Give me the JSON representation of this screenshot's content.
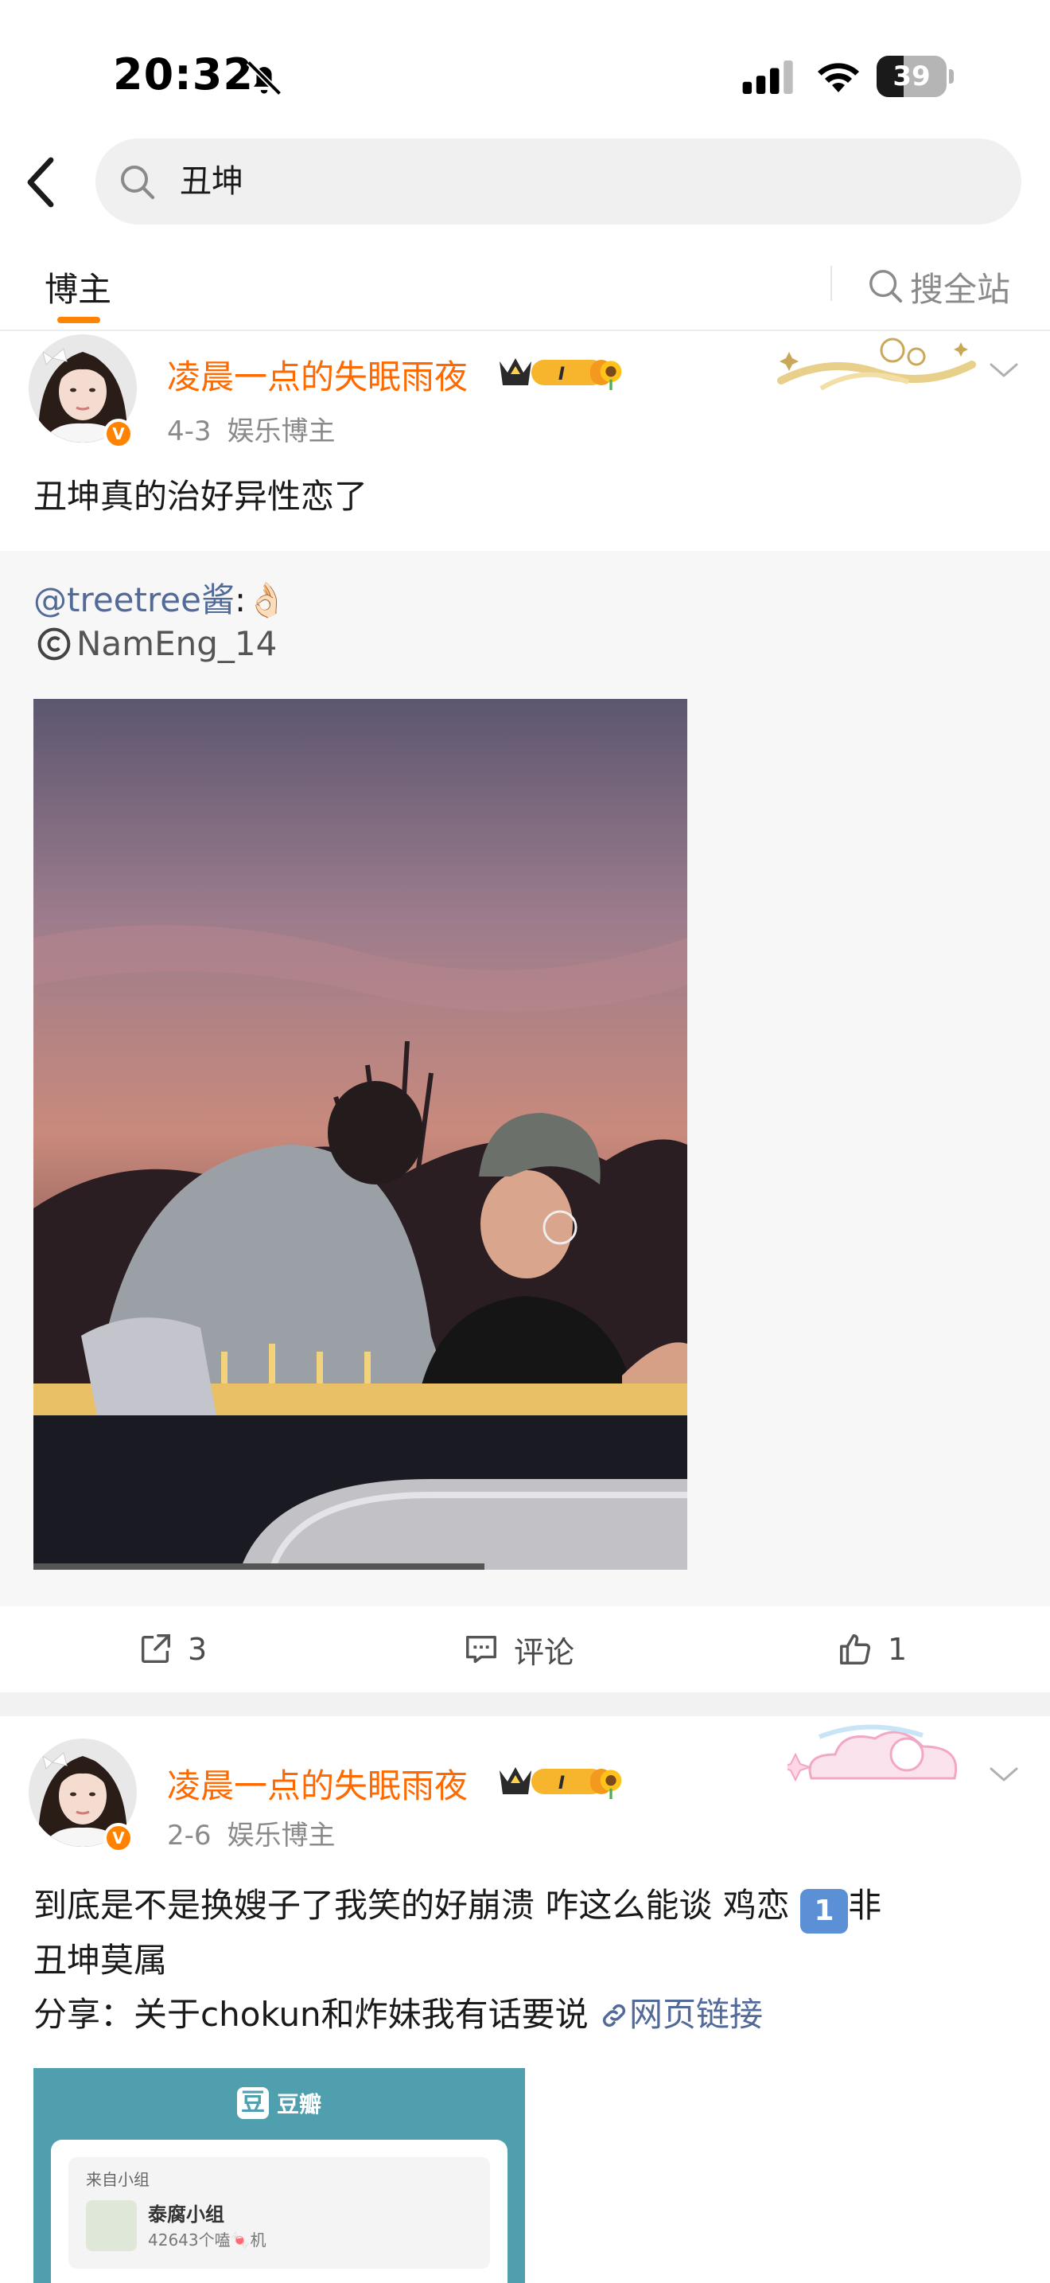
{
  "status_bar": {
    "time": "20:32",
    "battery_level": "39",
    "battery_fraction": 0.39
  },
  "search": {
    "query": "丑坤"
  },
  "tabs": {
    "blogger": "博主",
    "search_all": "搜全站"
  },
  "colors": {
    "accent": "#ff8200",
    "username": "#ff6a00",
    "link": "#526a98"
  },
  "icons": [
    "bell-slash-icon",
    "signal-icon",
    "wifi-icon",
    "back-icon",
    "search-icon",
    "repost-icon",
    "comment-icon",
    "like-icon",
    "chevron-down-icon",
    "link-icon",
    "sunflower-icon",
    "crown-badge"
  ],
  "posts": [
    {
      "username": "凌晨一点的失眠雨夜",
      "badge_level": "I",
      "date": "4-3",
      "category": "娱乐博主",
      "text": "丑坤真的治好异性恋了",
      "repost": {
        "author": "@treetree酱",
        "emoji": "👌🏻",
        "credit": "NamEng_14"
      },
      "video_progress_fraction": 0.69,
      "actions": {
        "reposts": "3",
        "comment_label": "评论",
        "likes": "1"
      }
    },
    {
      "username": "凌晨一点的失眠雨夜",
      "badge_level": "I",
      "date": "2-6",
      "category": "娱乐博主",
      "text_line1": "到底是不是换嫂子了我笑的好崩溃 咋这么能谈 鸡恋",
      "number_badge": "1",
      "text_line1_end": "非",
      "text_line2": "丑坤莫属",
      "share_prefix": "分享：关于chokun和炸妹我有话要说",
      "link_label": "网页链接",
      "share_card": {
        "site_mark": "豆",
        "site_name": "豆瓣",
        "from": "来自小组",
        "group_name": "泰腐小组",
        "group_count": "42643个嗑🍬机"
      }
    }
  ]
}
